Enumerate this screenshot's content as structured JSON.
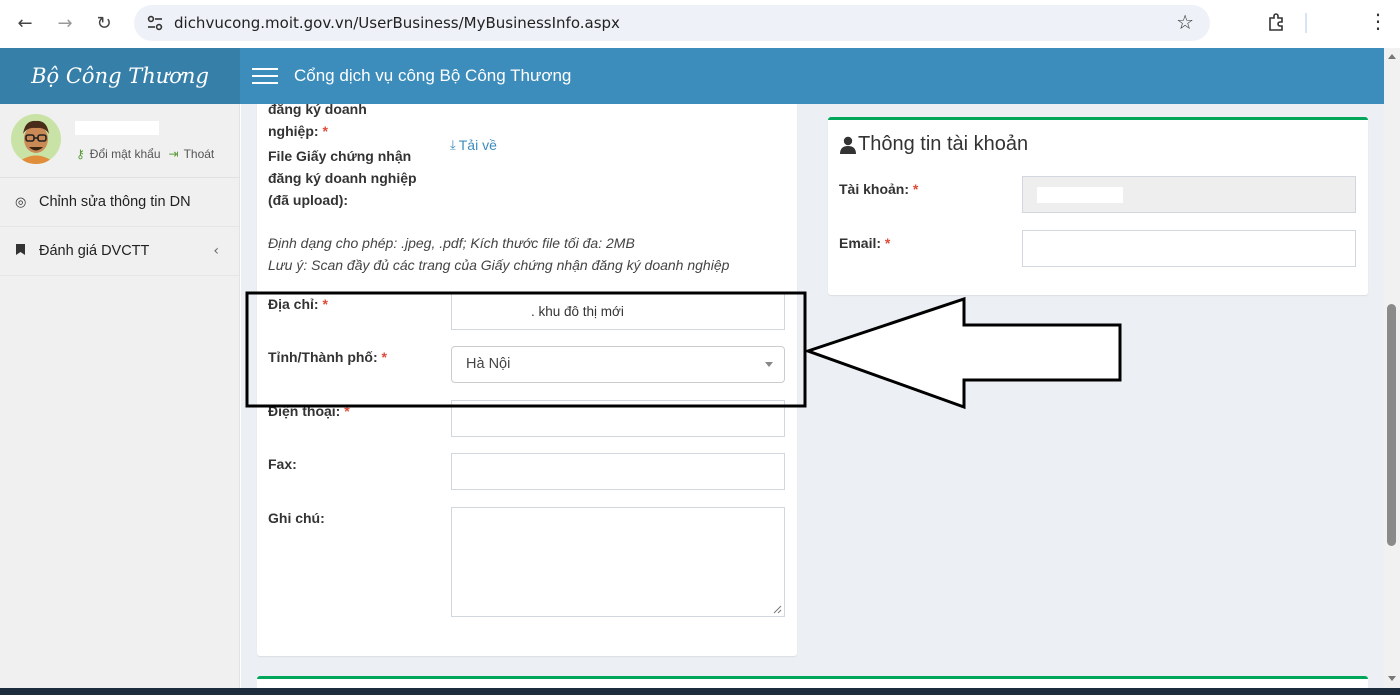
{
  "browser": {
    "url": "dichvucong.moit.gov.vn/UserBusiness/MyBusinessInfo.aspx"
  },
  "header": {
    "brand": "Bộ Công Thương",
    "portal_title": "Cổng dịch vụ công Bộ Công Thương",
    "accent_color": "#3c8dbc"
  },
  "sidebar": {
    "change_password": "Đổi mật khẩu",
    "logout": "Thoát",
    "items": [
      {
        "label": "Chỉnh sửa thông tin DN",
        "icon": "target-icon"
      },
      {
        "label": "Đánh giá DVCTT",
        "icon": "bookmark-icon"
      }
    ]
  },
  "form": {
    "cert_label_tail_1": "đăng ký doanh",
    "cert_label_tail_2": "nghiệp:",
    "file_label_1": "File Giấy chứng nhận",
    "file_label_2": "đăng ký doanh nghiệp",
    "file_label_3": "(đã upload):",
    "download_label": "Tải về",
    "note_formats": "Định dạng cho phép: .jpeg, .pdf; Kích thước file tối đa: 2MB",
    "note_scan": "Lưu ý: Scan đầy đủ các trang của Giấy chứng nhận đăng ký doanh nghiệp",
    "address_label": "Địa chỉ:",
    "address_value": ". khu đô thị mới",
    "province_label": "Tỉnh/Thành phố:",
    "province_value": "Hà Nội",
    "phone_label": "Điện thoại:",
    "fax_label": "Fax:",
    "note_label": "Ghi chú:",
    "required_mark": "*"
  },
  "account": {
    "title": "Thông tin tài khoản",
    "username_label": "Tài khoản:",
    "email_label": "Email:"
  }
}
